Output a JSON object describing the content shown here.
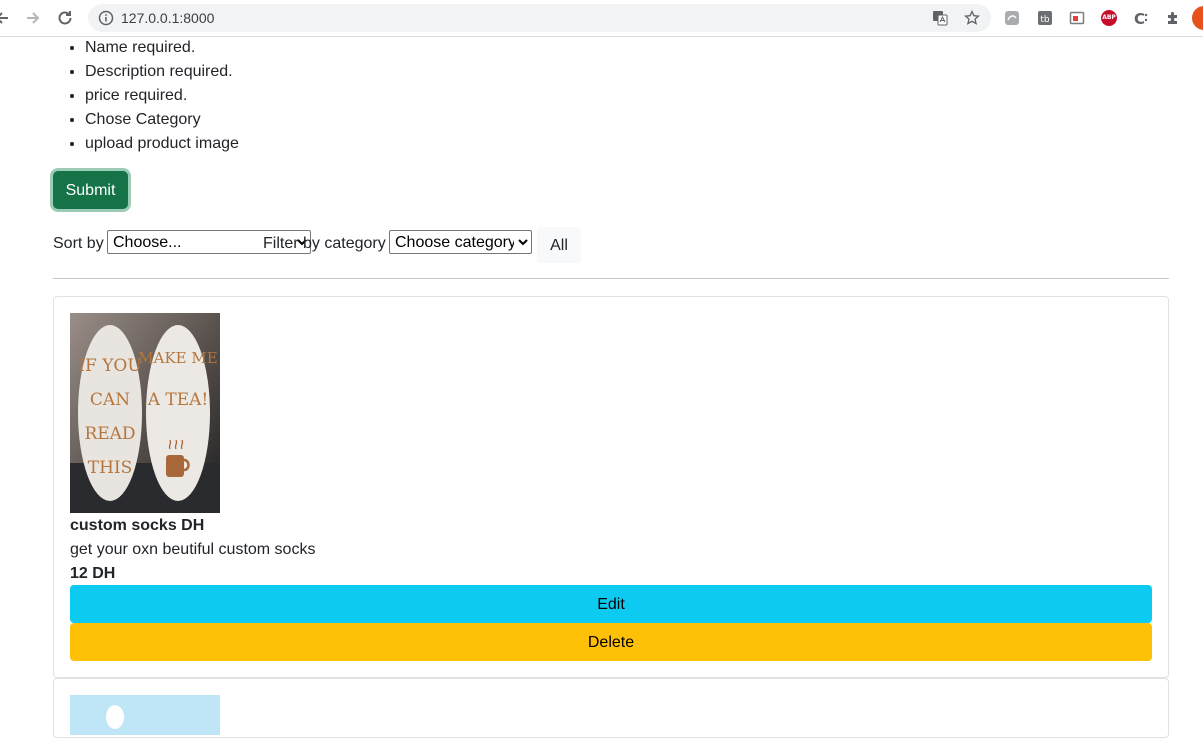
{
  "browser": {
    "url": "127.0.0.1:8000",
    "ext_abp_label": "ABP",
    "accent": "#e8501c"
  },
  "errors": [
    "Name required.",
    "Description required.",
    "price required.",
    "Chose Category",
    "upload product image"
  ],
  "form": {
    "submit_label": "Submit",
    "submit_color": "#157347"
  },
  "filters": {
    "sort_label": "Sort by",
    "sort_value": "Choose...",
    "filter_label": "Filter by category",
    "filter_value": "Choose category",
    "all_label": "All"
  },
  "products": [
    {
      "name": "custom socks DH",
      "description": "get your oxn beutiful custom socks",
      "price": "12 DH",
      "image_lettering_left": [
        "IF YOU",
        "CAN",
        "READ",
        "THIS"
      ],
      "image_lettering_right": [
        "MAKE ME",
        "A TEA!"
      ],
      "edit_label": "Edit",
      "delete_label": "Delete"
    }
  ],
  "colors": {
    "edit": "#0dcaf0",
    "delete": "#ffc107"
  }
}
